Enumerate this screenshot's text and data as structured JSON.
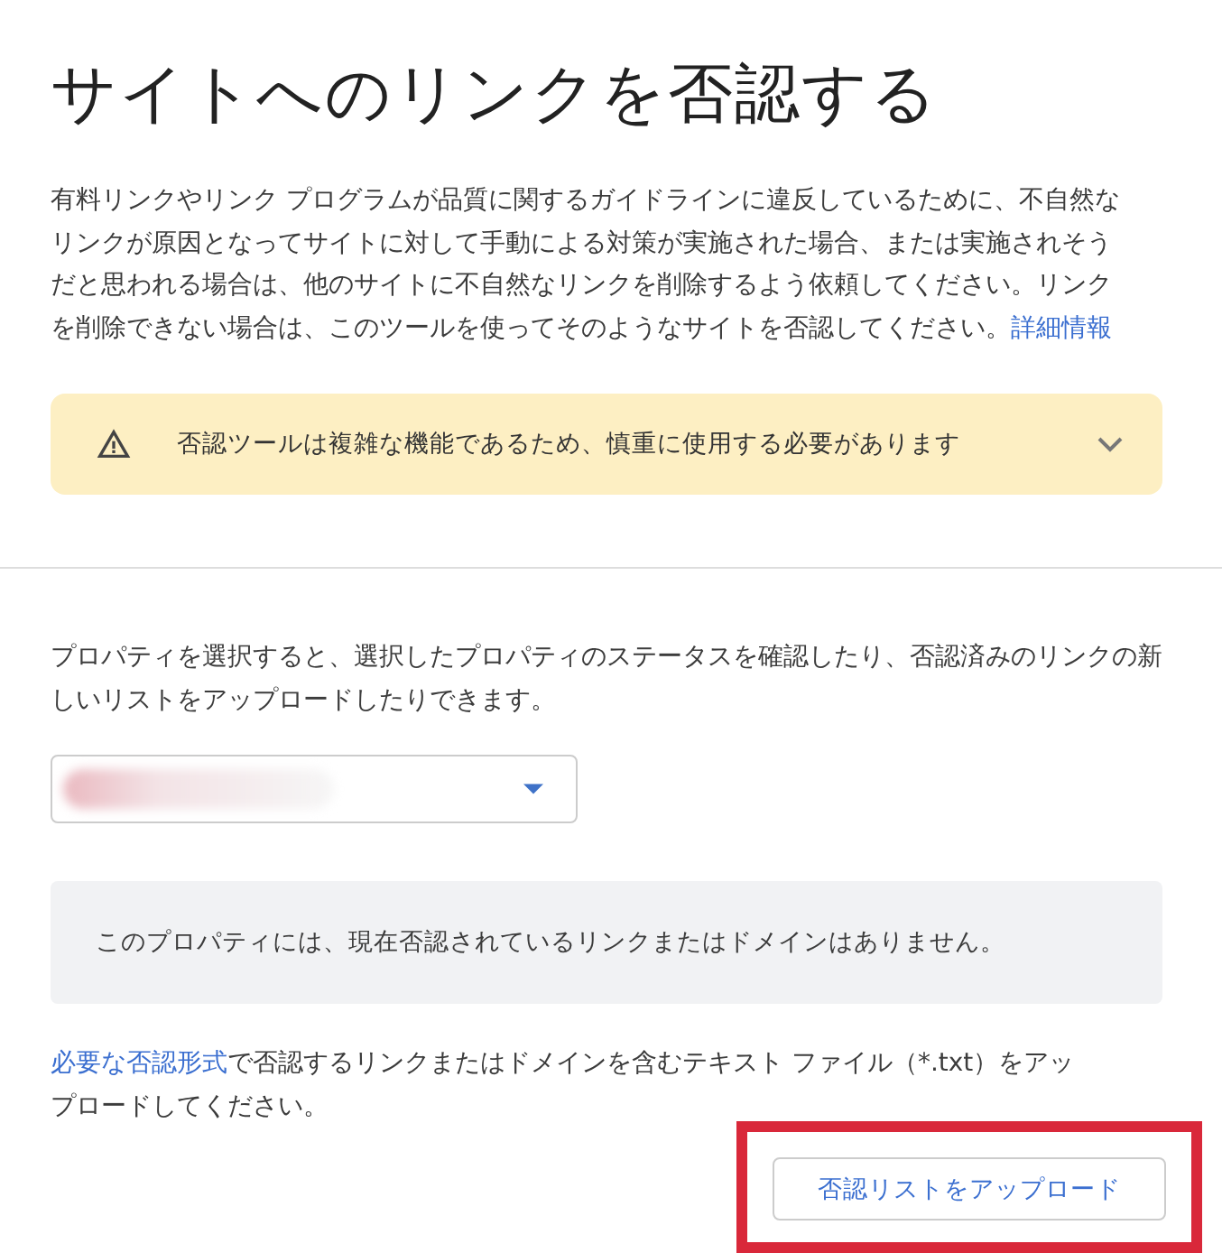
{
  "title": "サイトへのリンクを否認する",
  "intro": {
    "text": "有料リンクやリンク プログラムが品質に関するガイドラインに違反しているために、不自然なリンクが原因となってサイトに対して手動による対策が実施された場合、または実施されそうだと思われる場合は、他のサイトに不自然なリンクを削除するよう依頼してください。リンクを削除できない場合は、このツールを使ってそのようなサイトを否認してください。",
    "link": "詳細情報"
  },
  "warning": {
    "text": "否認ツールは複雑な機能であるため、慎重に使用する必要があります",
    "expanded": false
  },
  "property_intro": "プロパティを選択すると、選択したプロパティのステータスを確認したり、否認済みのリンクの新しいリストをアップロードしたりできます。",
  "notice": "このプロパティには、現在否認されているリンクまたはドメインはありません。",
  "upload_instructions": {
    "link": "必要な否認形式",
    "text": "で否認するリンクまたはドメインを含むテキスト ファイル（*.txt）をアップロードしてください。"
  },
  "upload_button": {
    "label": "否認リストをアップロード",
    "highlighted": true
  }
}
